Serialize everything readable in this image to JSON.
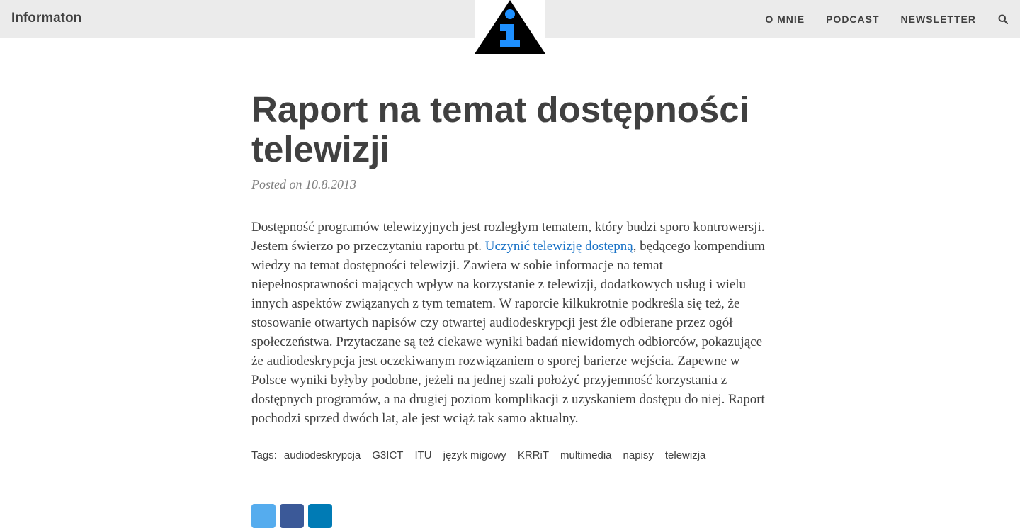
{
  "header": {
    "brand": "Informaton",
    "nav": [
      "O MNIE",
      "PODCAST",
      "NEWSLETTER"
    ]
  },
  "post": {
    "title": "Raport na temat dostępności telewizji",
    "meta": "Posted on 10.8.2013",
    "body": {
      "text_before_link": "Dostępność programów telewizyjnych jest rozległym tematem, który budzi sporo kontrowersji. Jestem świerzo po przeczytaniu raportu pt. ",
      "link_text": "Uczynić telewizję dostępną",
      "text_after_link": ", będącego kompendium wiedzy na temat dostępności telewizji. Zawiera w sobie informacje na temat niepełnosprawności mających wpływ na korzystanie z telewizji, dodatkowych usług i wielu innych aspektów związanych z tym tematem. W raporcie kilkukrotnie podkreśla się też, że stosowanie otwartych napisów czy otwartej audiodeskrypcji jest źle odbierane przez ogół społeczeństwa. Przytaczane są też ciekawe wyniki badań niewidomych odbiorców, pokazujące że audiodeskrypcja jest oczekiwanym rozwiązaniem o sporej barierze wejścia. Zapewne w Polsce wyniki byłyby podobne, jeżeli na jednej szali położyć przyjemność korzystania z dostępnych programów, a na drugiej poziom komplikacji z uzyskaniem dostępu do niej. Raport pochodzi sprzed dwóch lat, ale jest wciąż tak samo aktualny."
    },
    "tags_label": "Tags:",
    "tags": [
      "audiodeskrypcja",
      "G3ICT",
      "ITU",
      "język migowy",
      "KRRiT",
      "multimedia",
      "napisy",
      "telewizja"
    ]
  },
  "share": [
    {
      "icon": "twitter-icon",
      "color": "#55acee"
    },
    {
      "icon": "facebook-icon",
      "color": "#3b5998"
    },
    {
      "icon": "linkedin-icon",
      "color": "#007bb5"
    }
  ],
  "colors": {
    "text": "#404040",
    "link": "#1a73c7",
    "navbar_bg": "#ebebeb",
    "logo_blue": "#1e90ff"
  }
}
